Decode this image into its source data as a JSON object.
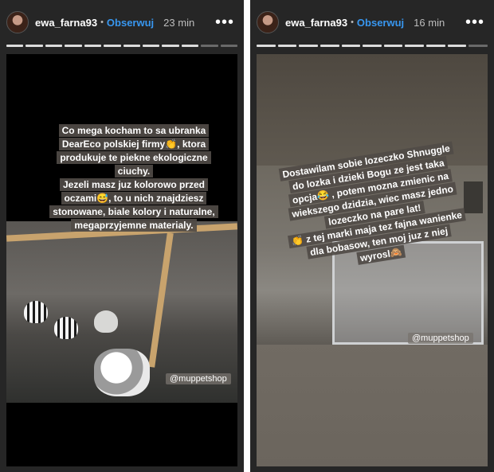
{
  "stories": [
    {
      "username": "ewa_farna93",
      "separator": "•",
      "follow_label": "Obserwuj",
      "time": "23 min",
      "more_label": "•••",
      "caption_lines": [
        "Co mega kocham to sa ubranka",
        "DearEco polskiej firmy👏, ktora",
        "produkuje te piekne ekologiczne",
        "ciuchy.",
        "Jezeli masz juz kolorowo przed",
        "oczami😅, to u nich znajdziesz",
        "stonowane, biale kolory i naturalne,",
        "megaprzyjemne materialy."
      ],
      "shop_tag": "@muppetshop"
    },
    {
      "username": "ewa_farna93",
      "separator": "•",
      "follow_label": "Obserwuj",
      "time": "16 min",
      "more_label": "•••",
      "caption_lines": [
        "Dostawilam sobie lozeczko Shnuggle",
        "do lozka i dzieki Bogu ze jest taka",
        "opcja😂 , potem mozna zmienic na",
        "wiekszego dzidzia, wiec masz jedno",
        "lozeczko na pare lat!",
        "👏 z tej marki maja tez fajna wanienke",
        "dla bobasow, ten moj juz z niej",
        "wyrosl🙈"
      ],
      "shop_tag": "@muppetshop"
    }
  ],
  "colors": {
    "background": "#262626",
    "follow": "#3897f0",
    "caption_bg": "#504b46"
  },
  "icons": [
    "avatar",
    "more-options-icon"
  ]
}
